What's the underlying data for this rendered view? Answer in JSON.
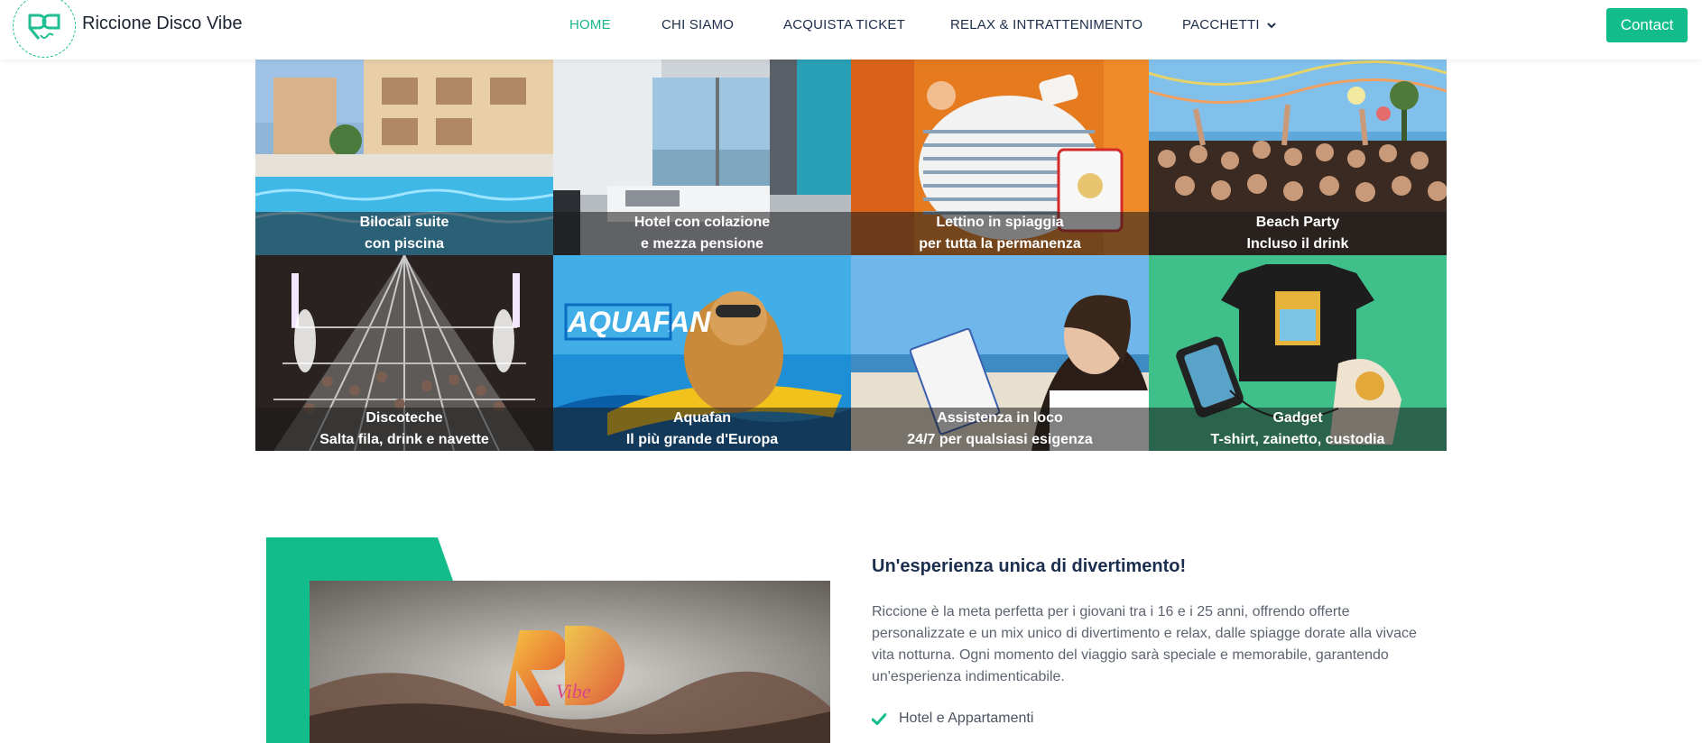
{
  "brand": {
    "name": "Riccione Disco Vibe",
    "logo_text": "RD Vibe"
  },
  "nav": {
    "items": [
      {
        "label": "HOME",
        "active": true
      },
      {
        "label": "CHI SIAMO",
        "active": false
      },
      {
        "label": "ACQUISTA TICKET",
        "active": false
      },
      {
        "label": "RELAX & INTRATTENIMENTO",
        "active": false
      },
      {
        "label": "PACCHETTI",
        "active": false,
        "dropdown": true
      }
    ],
    "contact_label": "Contact"
  },
  "tiles": [
    {
      "line1": "Bilocali suite",
      "line2": "con piscina",
      "image": "hotel-pool"
    },
    {
      "line1": "Hotel con colazione",
      "line2": "e mezza pensione",
      "image": "hotel-room"
    },
    {
      "line1": "Lettino in spiaggia",
      "line2": "per tutta la permanenza",
      "image": "beach-towel"
    },
    {
      "line1": "Beach Party",
      "line2": "Incluso il drink",
      "image": "beach-party-crowd"
    },
    {
      "line1": "Discoteche",
      "line2": "Salta fila, drink e navette",
      "image": "nightclub"
    },
    {
      "line1": "Aquafan",
      "line2": "Il più grande d'Europa",
      "image": "aquafan-monkey"
    },
    {
      "line1": "Assistenza in loco",
      "line2": "24/7 per qualsiasi esigenza",
      "image": "assistant-on-beach"
    },
    {
      "line1": "Gadget",
      "line2": "T-shirt, zainetto, custodia",
      "image": "gadgets"
    }
  ],
  "section": {
    "title": "Un'esperienza unica di divertimento!",
    "body": "Riccione è la meta perfetta per i giovani tra i 16 e i 25 anni, offrendo offerte personalizzate e un mix unico di divertimento e relax, dalle spiagge dorate alla vivace vita notturna. Ogni momento del viaggio sarà speciale e memorabile, garantendo un'esperienza indimenticabile.",
    "features": [
      "Hotel e Appartamenti"
    ]
  },
  "colors": {
    "accent": "#12bd8b",
    "nav_text": "#1d2e4a",
    "title": "#1b2e4e"
  },
  "icons": {
    "check": "check-icon",
    "dropdown": "chevron-down-icon"
  }
}
